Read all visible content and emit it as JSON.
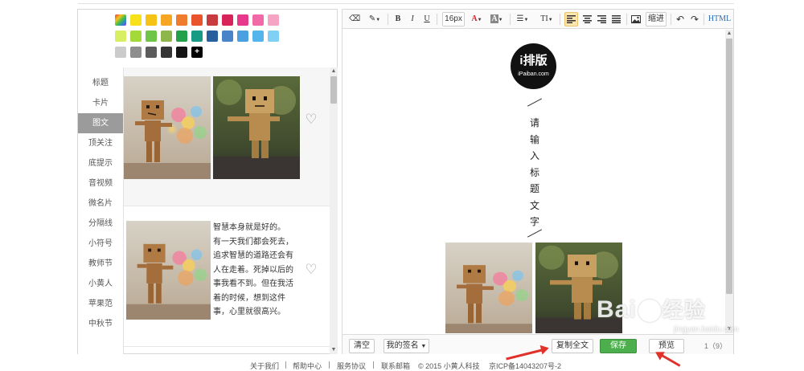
{
  "palette": {
    "row1": [
      "rainbow",
      "#f7e11b",
      "#f6c315",
      "#f5a623",
      "#ef7c2c",
      "#e9542d",
      "#c83b3f",
      "#d9245b",
      "#e7388b",
      "#f16aa7",
      "#f5a4c4"
    ],
    "row2": [
      "#d8ee63",
      "#a4d93a",
      "#6fc548",
      "#8fb64a",
      "#22a04a",
      "#179b84",
      "#285f9d",
      "#4a84c8",
      "#4ba0e0",
      "#54b4ec",
      "#7fd0f4"
    ],
    "row3": [
      "#cbcbcb",
      "#8e8e8e",
      "#5c5c5c",
      "#353535",
      "#151515",
      "plus"
    ],
    "plus_label": "+"
  },
  "categories": [
    {
      "label": "标题",
      "active": false
    },
    {
      "label": "卡片",
      "active": false
    },
    {
      "label": "图文",
      "active": true
    },
    {
      "label": "顶关注",
      "active": false
    },
    {
      "label": "底提示",
      "active": false
    },
    {
      "label": "音视频",
      "active": false
    },
    {
      "label": "微名片",
      "active": false
    },
    {
      "label": "分隔线",
      "active": false
    },
    {
      "label": "小符号",
      "active": false
    },
    {
      "label": "教师节",
      "active": false
    },
    {
      "label": "小黄人",
      "active": false
    },
    {
      "label": "苹果范",
      "active": false
    },
    {
      "label": "中秋节",
      "active": false
    }
  ],
  "templates": {
    "tpl2_text": [
      "智慧本身就是好的。",
      "有一天我们都会死去，",
      "追求智慧的道路还会有",
      "人在走着。死掉以后的",
      "事我看不到。但在我活",
      "着的时候，想到这件",
      "事，心里就很高兴。"
    ]
  },
  "toolbar": {
    "eraser": "⌫",
    "brush": "✎",
    "bold": "B",
    "italic": "I",
    "underline": "U",
    "font_size": "16px",
    "font_color": "A",
    "bg_color": "A",
    "list": "☰",
    "text_style": "TI",
    "indent_label": "缩进",
    "undo": "↶",
    "redo": "↷",
    "html": "HTML"
  },
  "editor": {
    "logo_main": "i排版",
    "logo_sub": "iPaiban.com",
    "title_chars": [
      "请",
      "输",
      "入",
      "标",
      "题",
      "文",
      "字"
    ]
  },
  "footer_bar": {
    "clear": "清空",
    "signature": "我的签名",
    "signature_arrow": "▼",
    "copy_all": "复制全文",
    "save": "保存",
    "preview": "预览",
    "count": "1（9）"
  },
  "watermark": {
    "text_a": "Bai",
    "text_b": "经验",
    "sub": "jingyan.baidu.com"
  },
  "site_footer": {
    "links": [
      "关于我们",
      "帮助中心",
      "服务协议",
      "联系邮箱",
      "© 2015 小黄人科技",
      "京ICP备14043207号-2"
    ]
  }
}
